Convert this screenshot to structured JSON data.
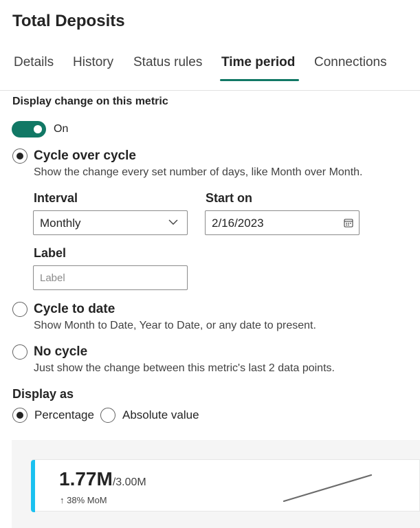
{
  "title": "Total Deposits",
  "tabs": [
    {
      "label": "Details"
    },
    {
      "label": "History"
    },
    {
      "label": "Status rules"
    },
    {
      "label": "Time period"
    },
    {
      "label": "Connections"
    }
  ],
  "active_tab": "Time period",
  "display_change": {
    "label": "Display change on this metric",
    "toggle_state": "On",
    "toggle_on": true
  },
  "options": {
    "cycle_over_cycle": {
      "title": "Cycle over cycle",
      "description": "Show the change every set number of days, like Month over Month.",
      "selected": true
    },
    "cycle_to_date": {
      "title": "Cycle to date",
      "description": "Show Month to Date, Year to Date, or any date to present.",
      "selected": false
    },
    "no_cycle": {
      "title": "No cycle",
      "description": "Just show the change between this metric's last 2 data points.",
      "selected": false
    }
  },
  "fields": {
    "interval_label": "Interval",
    "interval_value": "Monthly",
    "start_on_label": "Start on",
    "start_on_value": "2/16/2023",
    "label_label": "Label",
    "label_placeholder": "Label"
  },
  "display_as": {
    "label": "Display as",
    "percentage": "Percentage",
    "absolute": "Absolute value",
    "selected": "Percentage"
  },
  "preview": {
    "value": "1.77M",
    "target": "/3.00M",
    "change": "↑ 38% MoM"
  },
  "colors": {
    "accent_green": "#117865",
    "card_accent_blue": "#1bc1f0"
  }
}
